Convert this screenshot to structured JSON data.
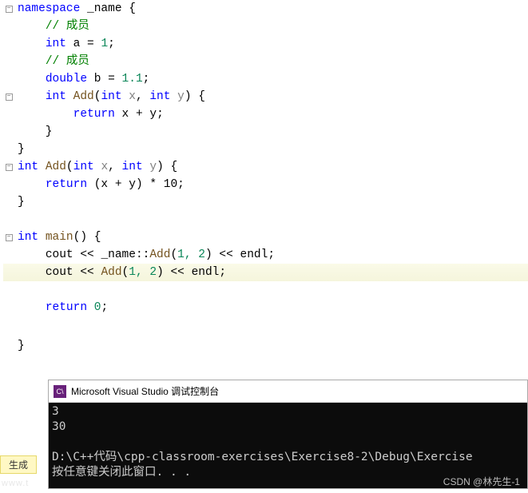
{
  "code": {
    "l1": {
      "kw": "namespace",
      "name": "_name"
    },
    "l2": {
      "comment": "// 成员"
    },
    "l3": {
      "type": "int",
      "name": "a",
      "val": "1"
    },
    "l4": {
      "comment": "// 成员"
    },
    "l5": {
      "type": "double",
      "name": "b",
      "val": "1.1"
    },
    "l6": {
      "type": "int",
      "name": "Add",
      "params": "int x, int y"
    },
    "l7": {
      "kw": "return",
      "expr": "x + y"
    },
    "l10": {
      "type": "int",
      "name": "Add",
      "params": "int x, int y"
    },
    "l11": {
      "kw": "return",
      "expr": "(x + y) * 10"
    },
    "l14": {
      "type": "int",
      "name": "main"
    },
    "l15": {
      "obj": "cout",
      "ns": "_name",
      "fn": "Add",
      "args": "1, 2",
      "endl": "endl"
    },
    "l16": {
      "obj": "cout",
      "fn": "Add",
      "args": "1, 2",
      "endl": "endl"
    },
    "l17": {
      "kw": "return",
      "val": "0"
    }
  },
  "console": {
    "title": "Microsoft Visual Studio 调试控制台",
    "out1": "3",
    "out2": "30",
    "path": "D:\\C++代码\\cpp-classroom-exercises\\Exercise8-2\\Debug\\Exercise",
    "prompt": "按任意键关闭此窗口. . ."
  },
  "build_label": "生成",
  "watermark": "CSDN @林先生-1",
  "watermark2": "www.t"
}
